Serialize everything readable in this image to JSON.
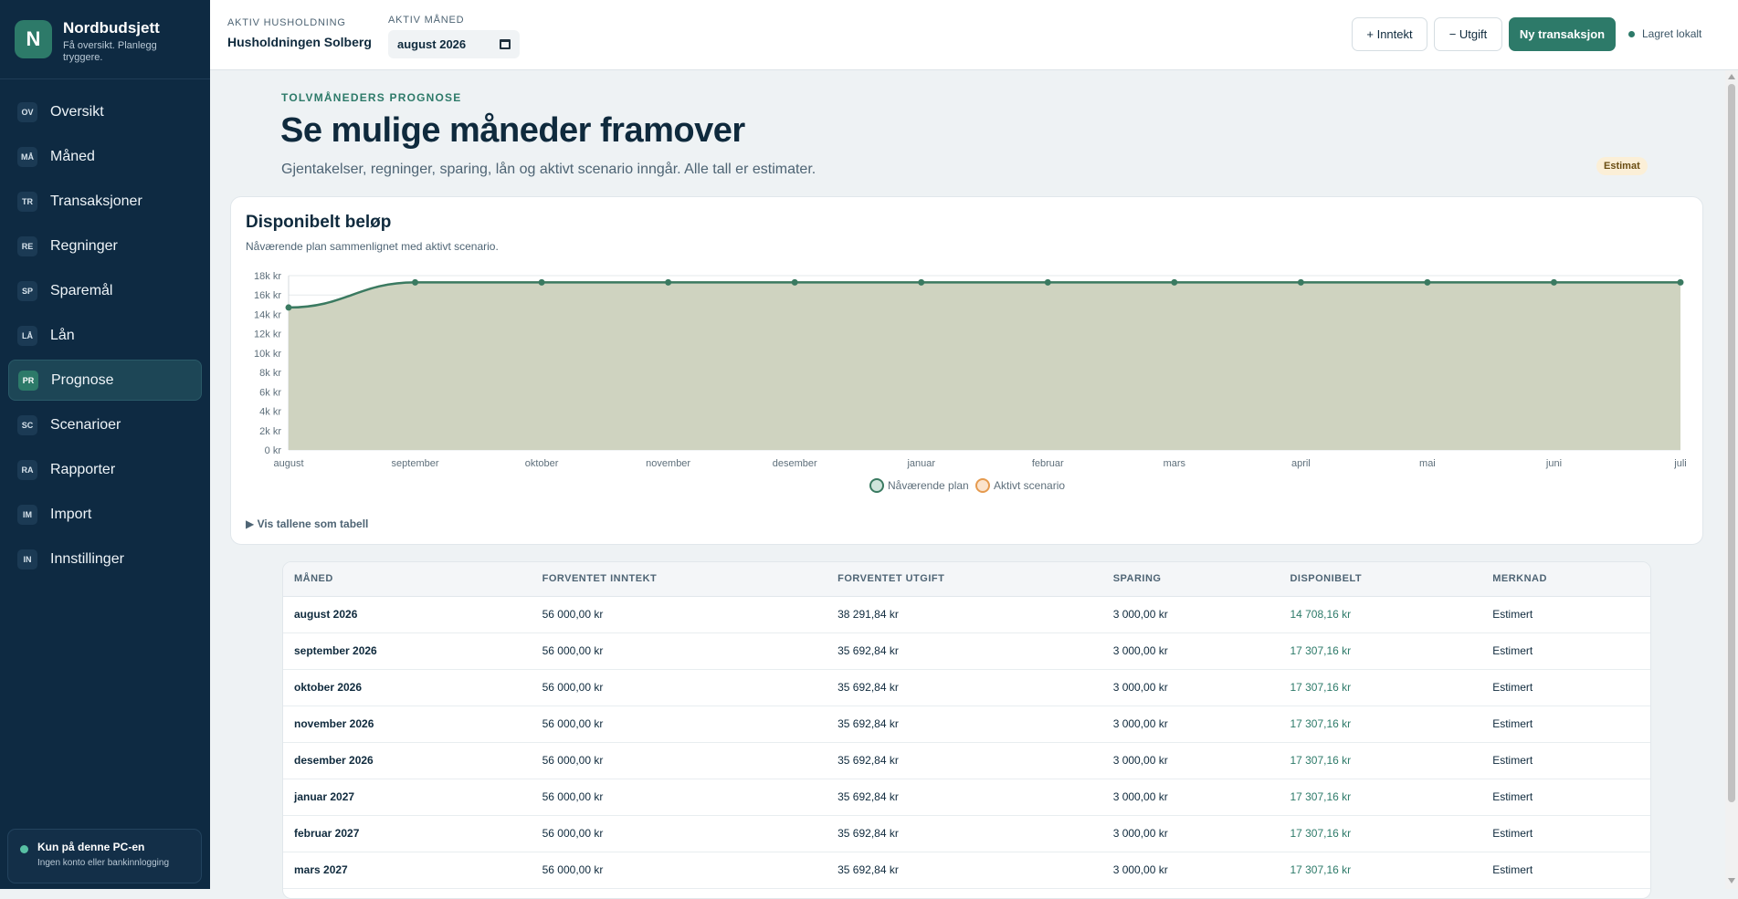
{
  "app": {
    "name": "Nordbudsjett",
    "tagline": "Få oversikt. Planlegg tryggere.",
    "logo_letter": "N"
  },
  "sidebar": {
    "items": [
      {
        "abbr": "OV",
        "label": "Oversikt"
      },
      {
        "abbr": "MÅ",
        "label": "Måned"
      },
      {
        "abbr": "TR",
        "label": "Transaksjoner"
      },
      {
        "abbr": "RE",
        "label": "Regninger"
      },
      {
        "abbr": "SP",
        "label": "Sparemål"
      },
      {
        "abbr": "LÅ",
        "label": "Lån"
      },
      {
        "abbr": "PR",
        "label": "Prognose",
        "active": true
      },
      {
        "abbr": "SC",
        "label": "Scenarioer"
      },
      {
        "abbr": "RA",
        "label": "Rapporter"
      },
      {
        "abbr": "IM",
        "label": "Import"
      },
      {
        "abbr": "IN",
        "label": "Innstillinger"
      }
    ],
    "local": {
      "title": "Kun på denne PC-en",
      "subtitle": "Ingen konto eller bankinnlogging"
    }
  },
  "topbar": {
    "household_label": "AKTIV HUSHOLDNING",
    "household_value": "Husholdningen Solberg",
    "month_label": "AKTIV MÅNED",
    "month_value": "august 2026",
    "income_button": "+ Inntekt",
    "expense_button": "− Utgift",
    "new_transaction_button": "Ny transaksjon",
    "saved_status": "Lagret lokalt"
  },
  "page": {
    "eyebrow": "TOLVMÅNEDERS PROGNOSE",
    "title": "Se mulige måneder framover",
    "lead": "Gjentakelser, regninger, sparing, lån og aktivt scenario inngår. Alle tall er estimater.",
    "badge": "Estimat"
  },
  "chart_card": {
    "title": "Disponibelt beløp",
    "subtitle": "Nåværende plan sammenlignet med aktivt scenario.",
    "table_toggle": "▶ Vis tallene som tabell"
  },
  "colors": {
    "accent": "#2d7a69",
    "sidebar": "#0e2a42",
    "scenario": "#e59a4f",
    "area_fill": "#cfd3c0"
  },
  "chart_data": {
    "type": "area",
    "categories": [
      "august",
      "september",
      "oktober",
      "november",
      "desember",
      "januar",
      "februar",
      "mars",
      "april",
      "mai",
      "juni",
      "juli"
    ],
    "series": [
      {
        "name": "Nåværende plan",
        "values": [
          14708.16,
          17307.16,
          17307.16,
          17307.16,
          17307.16,
          17307.16,
          17307.16,
          17307.16,
          17307.16,
          17307.16,
          17307.16,
          17307.16
        ]
      },
      {
        "name": "Aktivt scenario",
        "values": [
          14708.16,
          17307.16,
          17307.16,
          17307.16,
          17307.16,
          17307.16,
          17307.16,
          17307.16,
          17307.16,
          17307.16,
          17307.16,
          17307.16
        ]
      }
    ],
    "yticks": [
      "0 kr",
      "2k kr",
      "4k kr",
      "6k kr",
      "8k kr",
      "10k kr",
      "12k kr",
      "14k kr",
      "16k kr",
      "18k kr"
    ],
    "ylim": [
      0,
      18000
    ],
    "legend": "bottom",
    "grid": true
  },
  "table": {
    "headers": [
      "MÅNED",
      "FORVENTET INNTEKT",
      "FORVENTET UTGIFT",
      "SPARING",
      "DISPONIBELT",
      "MERKNAD"
    ],
    "rows": [
      [
        "august 2026",
        "56 000,00 kr",
        "38 291,84 kr",
        "3 000,00 kr",
        "14 708,16 kr",
        "Estimert"
      ],
      [
        "september 2026",
        "56 000,00 kr",
        "35 692,84 kr",
        "3 000,00 kr",
        "17 307,16 kr",
        "Estimert"
      ],
      [
        "oktober 2026",
        "56 000,00 kr",
        "35 692,84 kr",
        "3 000,00 kr",
        "17 307,16 kr",
        "Estimert"
      ],
      [
        "november 2026",
        "56 000,00 kr",
        "35 692,84 kr",
        "3 000,00 kr",
        "17 307,16 kr",
        "Estimert"
      ],
      [
        "desember 2026",
        "56 000,00 kr",
        "35 692,84 kr",
        "3 000,00 kr",
        "17 307,16 kr",
        "Estimert"
      ],
      [
        "januar 2027",
        "56 000,00 kr",
        "35 692,84 kr",
        "3 000,00 kr",
        "17 307,16 kr",
        "Estimert"
      ],
      [
        "februar 2027",
        "56 000,00 kr",
        "35 692,84 kr",
        "3 000,00 kr",
        "17 307,16 kr",
        "Estimert"
      ],
      [
        "mars 2027",
        "56 000,00 kr",
        "35 692,84 kr",
        "3 000,00 kr",
        "17 307,16 kr",
        "Estimert"
      ]
    ]
  }
}
